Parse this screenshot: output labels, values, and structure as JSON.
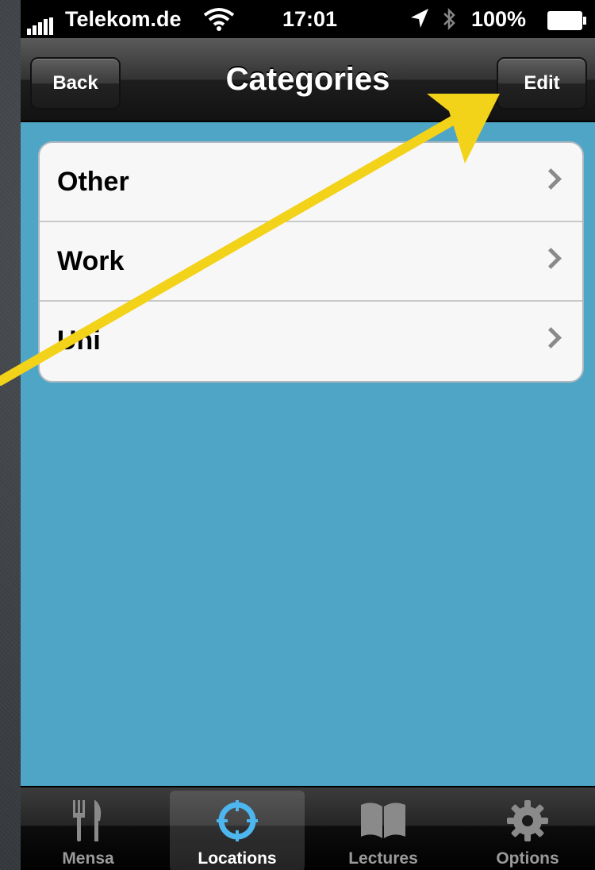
{
  "status_bar": {
    "carrier": "Telekom.de",
    "time": "17:01",
    "battery": "100%"
  },
  "nav_bar": {
    "back_label": "Back",
    "title": "Categories",
    "edit_label": "Edit"
  },
  "categories": [
    {
      "label": "Other"
    },
    {
      "label": "Work"
    },
    {
      "label": "Uni"
    }
  ],
  "tab_bar": {
    "items": [
      {
        "label": "Mensa",
        "icon": "fork-knife-icon"
      },
      {
        "label": "Locations",
        "icon": "crosshair-icon",
        "selected": true
      },
      {
        "label": "Lectures",
        "icon": "book-icon"
      },
      {
        "label": "Options",
        "icon": "gear-icon"
      }
    ]
  },
  "colors": {
    "content_background": "#4fa5c6",
    "annotation_arrow": "#f3d21a"
  }
}
